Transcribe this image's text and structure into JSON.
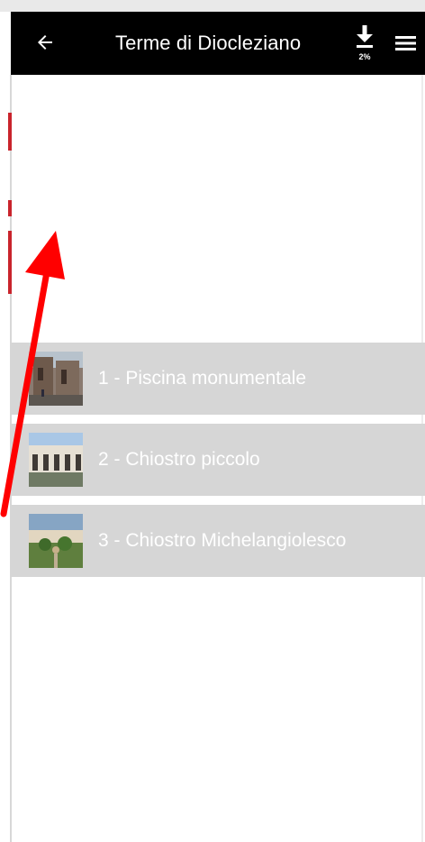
{
  "header": {
    "title": "Terme di Diocleziano",
    "back_icon": "arrow-left-icon",
    "download_icon": "download-icon",
    "download_progress": "2%",
    "menu_icon": "hamburger-menu-icon",
    "background_color": "#000000",
    "text_color": "#ffffff"
  },
  "list": {
    "item_background": "#d6d6d6",
    "item_text_color": "#ffffff",
    "items": [
      {
        "label": "1 - Piscina monumentale",
        "thumbnail": "ancient-ruins-photo"
      },
      {
        "label": "2 - Chiostro piccolo",
        "thumbnail": "cloister-arcade-photo"
      },
      {
        "label": "3 - Chiostro Michelangiolesco",
        "thumbnail": "cloister-garden-photo"
      }
    ]
  },
  "annotation": {
    "icon": "red-arrow-icon",
    "color": "#ff0000"
  }
}
